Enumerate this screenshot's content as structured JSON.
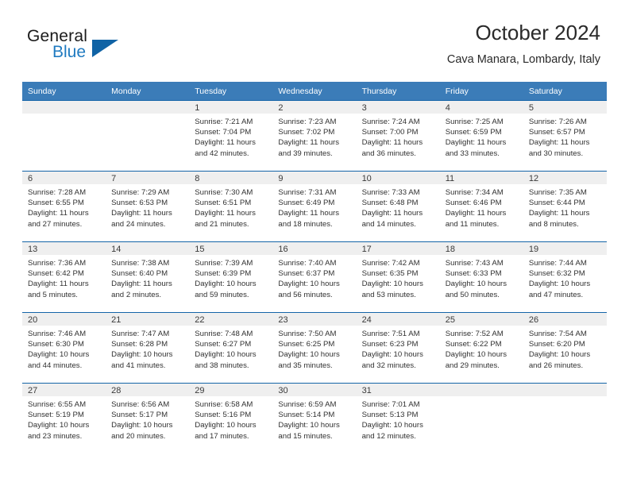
{
  "logo": {
    "word_top": "General",
    "word_bottom": "Blue",
    "triangle_color": "#1063a5",
    "blue_text_color": "#1f7ac0"
  },
  "header": {
    "title": "October 2024",
    "subtitle": "Cava Manara, Lombardy, Italy"
  },
  "theme": {
    "header_row_bg": "#3b7cb8",
    "header_row_text": "#ffffff",
    "row_separator": "#1565a8",
    "daynum_strip_bg": "#efefef"
  },
  "weekdays": [
    "Sunday",
    "Monday",
    "Tuesday",
    "Wednesday",
    "Thursday",
    "Friday",
    "Saturday"
  ],
  "labels": {
    "sunrise_prefix": "Sunrise: ",
    "sunset_prefix": "Sunset: ",
    "daylight_prefix": "Daylight: "
  },
  "weeks": [
    [
      {
        "day": "",
        "empty": true
      },
      {
        "day": "",
        "empty": true
      },
      {
        "day": "1",
        "sunrise": "Sunrise: 7:21 AM",
        "sunset": "Sunset: 7:04 PM",
        "daylight1": "Daylight: 11 hours",
        "daylight2": "and 42 minutes."
      },
      {
        "day": "2",
        "sunrise": "Sunrise: 7:23 AM",
        "sunset": "Sunset: 7:02 PM",
        "daylight1": "Daylight: 11 hours",
        "daylight2": "and 39 minutes."
      },
      {
        "day": "3",
        "sunrise": "Sunrise: 7:24 AM",
        "sunset": "Sunset: 7:00 PM",
        "daylight1": "Daylight: 11 hours",
        "daylight2": "and 36 minutes."
      },
      {
        "day": "4",
        "sunrise": "Sunrise: 7:25 AM",
        "sunset": "Sunset: 6:59 PM",
        "daylight1": "Daylight: 11 hours",
        "daylight2": "and 33 minutes."
      },
      {
        "day": "5",
        "sunrise": "Sunrise: 7:26 AM",
        "sunset": "Sunset: 6:57 PM",
        "daylight1": "Daylight: 11 hours",
        "daylight2": "and 30 minutes."
      }
    ],
    [
      {
        "day": "6",
        "sunrise": "Sunrise: 7:28 AM",
        "sunset": "Sunset: 6:55 PM",
        "daylight1": "Daylight: 11 hours",
        "daylight2": "and 27 minutes."
      },
      {
        "day": "7",
        "sunrise": "Sunrise: 7:29 AM",
        "sunset": "Sunset: 6:53 PM",
        "daylight1": "Daylight: 11 hours",
        "daylight2": "and 24 minutes."
      },
      {
        "day": "8",
        "sunrise": "Sunrise: 7:30 AM",
        "sunset": "Sunset: 6:51 PM",
        "daylight1": "Daylight: 11 hours",
        "daylight2": "and 21 minutes."
      },
      {
        "day": "9",
        "sunrise": "Sunrise: 7:31 AM",
        "sunset": "Sunset: 6:49 PM",
        "daylight1": "Daylight: 11 hours",
        "daylight2": "and 18 minutes."
      },
      {
        "day": "10",
        "sunrise": "Sunrise: 7:33 AM",
        "sunset": "Sunset: 6:48 PM",
        "daylight1": "Daylight: 11 hours",
        "daylight2": "and 14 minutes."
      },
      {
        "day": "11",
        "sunrise": "Sunrise: 7:34 AM",
        "sunset": "Sunset: 6:46 PM",
        "daylight1": "Daylight: 11 hours",
        "daylight2": "and 11 minutes."
      },
      {
        "day": "12",
        "sunrise": "Sunrise: 7:35 AM",
        "sunset": "Sunset: 6:44 PM",
        "daylight1": "Daylight: 11 hours",
        "daylight2": "and 8 minutes."
      }
    ],
    [
      {
        "day": "13",
        "sunrise": "Sunrise: 7:36 AM",
        "sunset": "Sunset: 6:42 PM",
        "daylight1": "Daylight: 11 hours",
        "daylight2": "and 5 minutes."
      },
      {
        "day": "14",
        "sunrise": "Sunrise: 7:38 AM",
        "sunset": "Sunset: 6:40 PM",
        "daylight1": "Daylight: 11 hours",
        "daylight2": "and 2 minutes."
      },
      {
        "day": "15",
        "sunrise": "Sunrise: 7:39 AM",
        "sunset": "Sunset: 6:39 PM",
        "daylight1": "Daylight: 10 hours",
        "daylight2": "and 59 minutes."
      },
      {
        "day": "16",
        "sunrise": "Sunrise: 7:40 AM",
        "sunset": "Sunset: 6:37 PM",
        "daylight1": "Daylight: 10 hours",
        "daylight2": "and 56 minutes."
      },
      {
        "day": "17",
        "sunrise": "Sunrise: 7:42 AM",
        "sunset": "Sunset: 6:35 PM",
        "daylight1": "Daylight: 10 hours",
        "daylight2": "and 53 minutes."
      },
      {
        "day": "18",
        "sunrise": "Sunrise: 7:43 AM",
        "sunset": "Sunset: 6:33 PM",
        "daylight1": "Daylight: 10 hours",
        "daylight2": "and 50 minutes."
      },
      {
        "day": "19",
        "sunrise": "Sunrise: 7:44 AM",
        "sunset": "Sunset: 6:32 PM",
        "daylight1": "Daylight: 10 hours",
        "daylight2": "and 47 minutes."
      }
    ],
    [
      {
        "day": "20",
        "sunrise": "Sunrise: 7:46 AM",
        "sunset": "Sunset: 6:30 PM",
        "daylight1": "Daylight: 10 hours",
        "daylight2": "and 44 minutes."
      },
      {
        "day": "21",
        "sunrise": "Sunrise: 7:47 AM",
        "sunset": "Sunset: 6:28 PM",
        "daylight1": "Daylight: 10 hours",
        "daylight2": "and 41 minutes."
      },
      {
        "day": "22",
        "sunrise": "Sunrise: 7:48 AM",
        "sunset": "Sunset: 6:27 PM",
        "daylight1": "Daylight: 10 hours",
        "daylight2": "and 38 minutes."
      },
      {
        "day": "23",
        "sunrise": "Sunrise: 7:50 AM",
        "sunset": "Sunset: 6:25 PM",
        "daylight1": "Daylight: 10 hours",
        "daylight2": "and 35 minutes."
      },
      {
        "day": "24",
        "sunrise": "Sunrise: 7:51 AM",
        "sunset": "Sunset: 6:23 PM",
        "daylight1": "Daylight: 10 hours",
        "daylight2": "and 32 minutes."
      },
      {
        "day": "25",
        "sunrise": "Sunrise: 7:52 AM",
        "sunset": "Sunset: 6:22 PM",
        "daylight1": "Daylight: 10 hours",
        "daylight2": "and 29 minutes."
      },
      {
        "day": "26",
        "sunrise": "Sunrise: 7:54 AM",
        "sunset": "Sunset: 6:20 PM",
        "daylight1": "Daylight: 10 hours",
        "daylight2": "and 26 minutes."
      }
    ],
    [
      {
        "day": "27",
        "sunrise": "Sunrise: 6:55 AM",
        "sunset": "Sunset: 5:19 PM",
        "daylight1": "Daylight: 10 hours",
        "daylight2": "and 23 minutes."
      },
      {
        "day": "28",
        "sunrise": "Sunrise: 6:56 AM",
        "sunset": "Sunset: 5:17 PM",
        "daylight1": "Daylight: 10 hours",
        "daylight2": "and 20 minutes."
      },
      {
        "day": "29",
        "sunrise": "Sunrise: 6:58 AM",
        "sunset": "Sunset: 5:16 PM",
        "daylight1": "Daylight: 10 hours",
        "daylight2": "and 17 minutes."
      },
      {
        "day": "30",
        "sunrise": "Sunrise: 6:59 AM",
        "sunset": "Sunset: 5:14 PM",
        "daylight1": "Daylight: 10 hours",
        "daylight2": "and 15 minutes."
      },
      {
        "day": "31",
        "sunrise": "Sunrise: 7:01 AM",
        "sunset": "Sunset: 5:13 PM",
        "daylight1": "Daylight: 10 hours",
        "daylight2": "and 12 minutes."
      },
      {
        "day": "",
        "empty": true
      },
      {
        "day": "",
        "empty": true
      }
    ]
  ]
}
